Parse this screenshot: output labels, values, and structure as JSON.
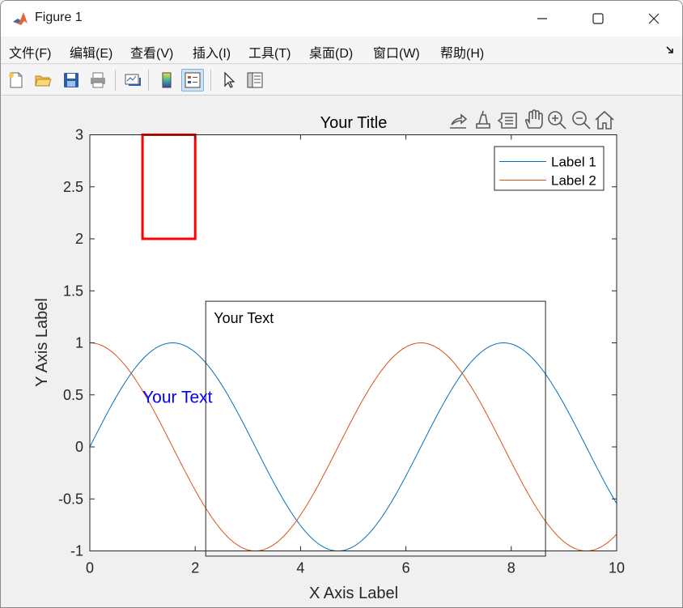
{
  "window": {
    "title": "Figure 1",
    "icon": "matlab-logo-icon",
    "controls": [
      "minimize-icon",
      "maximize-icon",
      "close-icon"
    ]
  },
  "menu": [
    {
      "label": "文件(F)",
      "name": "menu-file"
    },
    {
      "label": "编辑(E)",
      "name": "menu-edit"
    },
    {
      "label": "查看(V)",
      "name": "menu-view"
    },
    {
      "label": "插入(I)",
      "name": "menu-insert"
    },
    {
      "label": "工具(T)",
      "name": "menu-tools"
    },
    {
      "label": "桌面(D)",
      "name": "menu-desktop"
    },
    {
      "label": "窗口(W)",
      "name": "menu-window"
    },
    {
      "label": "帮助(H)",
      "name": "menu-help"
    }
  ],
  "toolbar": [
    "new-figure-icon",
    "open-file-icon",
    "save-icon",
    "print-icon",
    "link-plot-icon",
    "insert-colorbar-icon",
    "insert-legend-icon",
    "edit-plot-icon",
    "property-inspector-icon"
  ],
  "axes_toolbar": [
    "export-icon",
    "brush-icon",
    "data-tips-icon",
    "pan-icon",
    "zoom-in-icon",
    "zoom-out-icon",
    "restore-view-icon"
  ],
  "colors": {
    "series1": "#0072bd",
    "series2": "#d95319",
    "red_rect": "#ff0000",
    "blue_text": "#0000ff",
    "axes": "#262626"
  },
  "chart_data": {
    "type": "line",
    "title": "Your Title",
    "xlabel": "X Axis Label",
    "ylabel": "Y Axis Label",
    "xlim": [
      0,
      10
    ],
    "ylim": [
      -1,
      3
    ],
    "xticks": [
      0,
      2,
      4,
      6,
      8,
      10
    ],
    "yticks": [
      -1,
      -0.5,
      0,
      0.5,
      1,
      1.5,
      2,
      2.5,
      3
    ],
    "xtick_labels": [
      "0",
      "2",
      "4",
      "6",
      "8",
      "10"
    ],
    "ytick_labels": [
      "-1",
      "-0.5",
      "0",
      "0.5",
      "1",
      "1.5",
      "2",
      "2.5",
      "3"
    ],
    "grid": false,
    "legend": {
      "placement": "top-right",
      "entries": [
        "Label 1",
        "Label 2"
      ]
    },
    "series": [
      {
        "name": "Label 1",
        "function": "sin(x)",
        "x_start": 0,
        "x_end": 10
      },
      {
        "name": "Label 2",
        "function": "cos(x)",
        "x_start": 0,
        "x_end": 10
      }
    ],
    "annotations": [
      {
        "type": "rectangle",
        "x_range": [
          1,
          2
        ],
        "y_range": [
          2,
          3
        ],
        "color": "#ff0000"
      },
      {
        "type": "textbox",
        "text": "Your Text",
        "x_range": [
          2.2,
          8.65
        ],
        "y_range": [
          -1.05,
          1.4
        ]
      },
      {
        "type": "text",
        "text": "Your Text",
        "x": 1,
        "y": 0.48,
        "color": "#0000ff"
      }
    ]
  }
}
